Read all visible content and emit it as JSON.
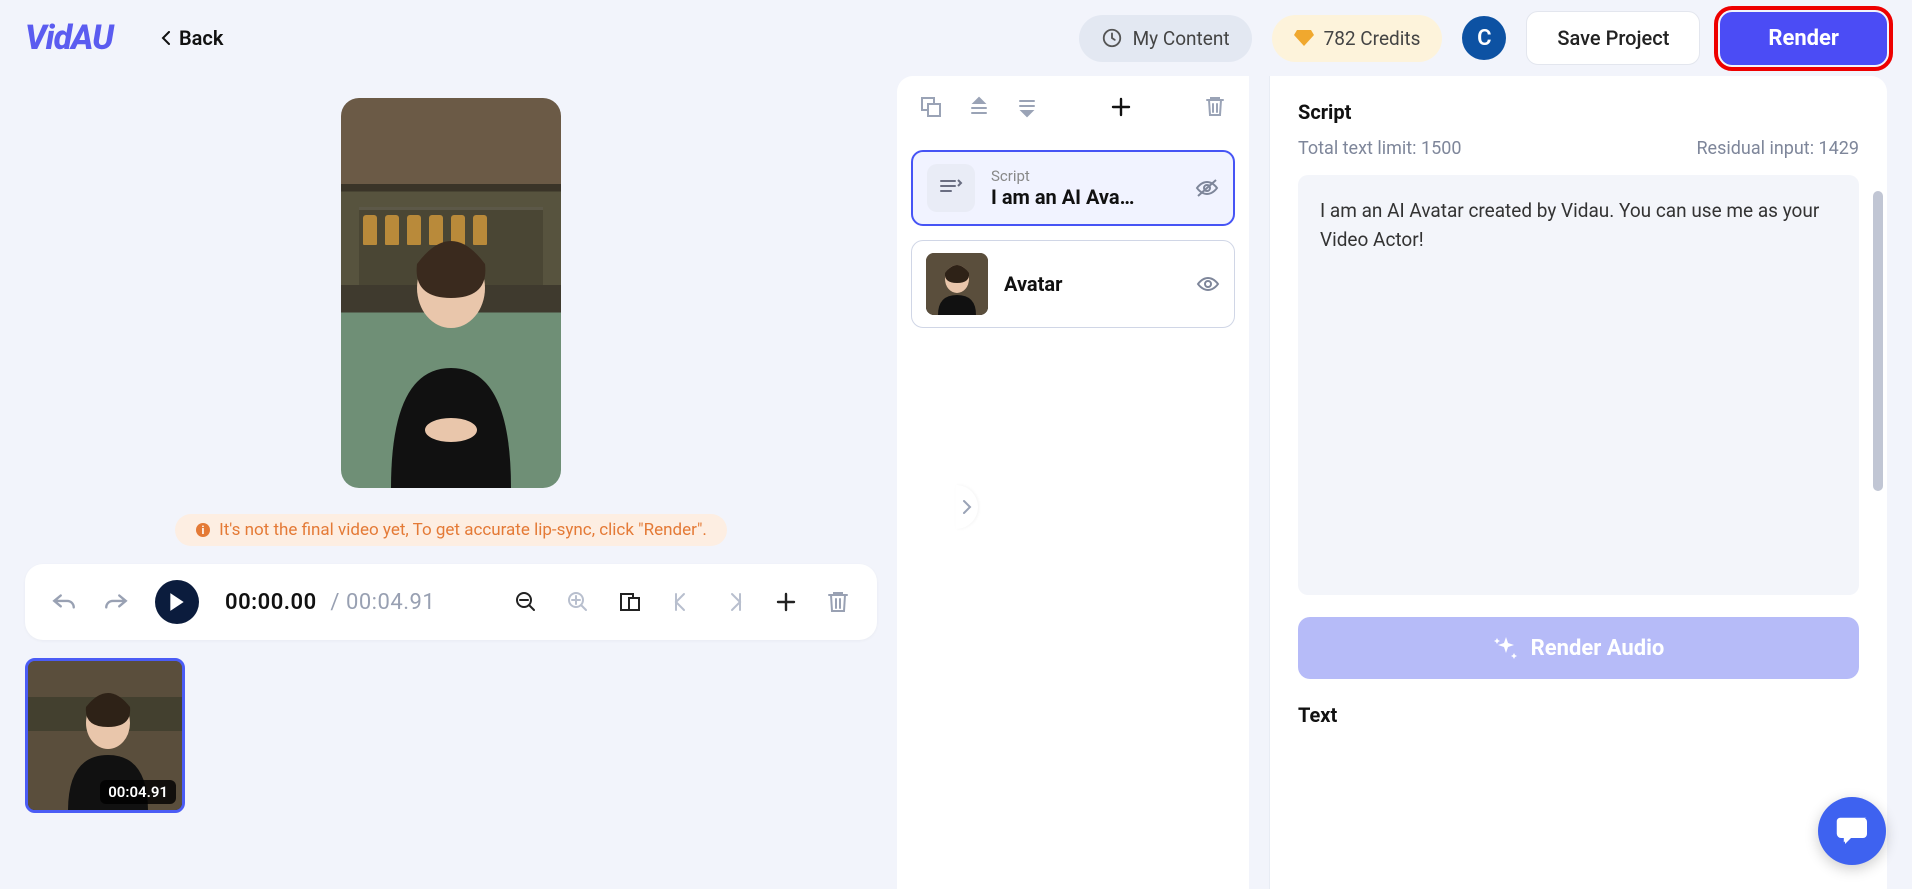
{
  "header": {
    "logo": "VidAU",
    "back": "Back",
    "my_content": "My Content",
    "credits": "782 Credits",
    "avatar_initial": "C",
    "save": "Save Project",
    "render": "Render"
  },
  "preview": {
    "notice": "It's not the final video yet, To get accurate lip-sync, click \"Render\"."
  },
  "timeline": {
    "current": "00:00.00",
    "total": "00:04.91",
    "thumb_duration": "00:04.91"
  },
  "layers": {
    "script_label": "Script",
    "script_value": "I am an AI Ava…",
    "avatar_label": "Avatar"
  },
  "script": {
    "heading": "Script",
    "limit_label": "Total text limit: 1500",
    "residual_label": "Residual input: 1429",
    "text": "I am an AI Avatar created by Vidau. You can use me as your Video Actor!",
    "render_audio": "Render Audio",
    "text_heading": "Text"
  }
}
